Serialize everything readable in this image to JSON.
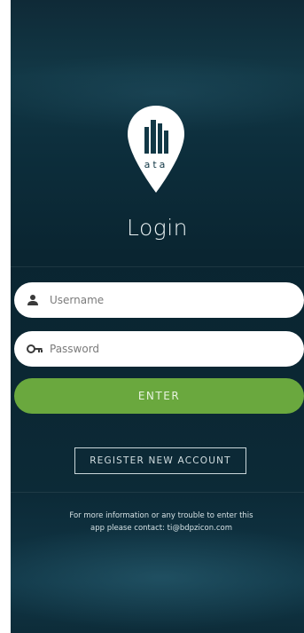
{
  "app": {
    "logo_text": "ata",
    "title": "Login"
  },
  "form": {
    "username_placeholder": "Username",
    "password_placeholder": "Password",
    "enter_label": "ENTER"
  },
  "register": {
    "label": "REGISTER NEW ACCOUNT"
  },
  "info": {
    "line1": "For more information or any trouble to enter this",
    "line2": "app please contact: ti@bdpzicon.com"
  },
  "icons": {
    "username": "user-icon",
    "password": "key-icon",
    "logo": "location-pin-city-logo-icon"
  },
  "colors": {
    "background": "#0b2733",
    "accent_green": "#6aa83e",
    "field_bg": "#ffffff"
  }
}
